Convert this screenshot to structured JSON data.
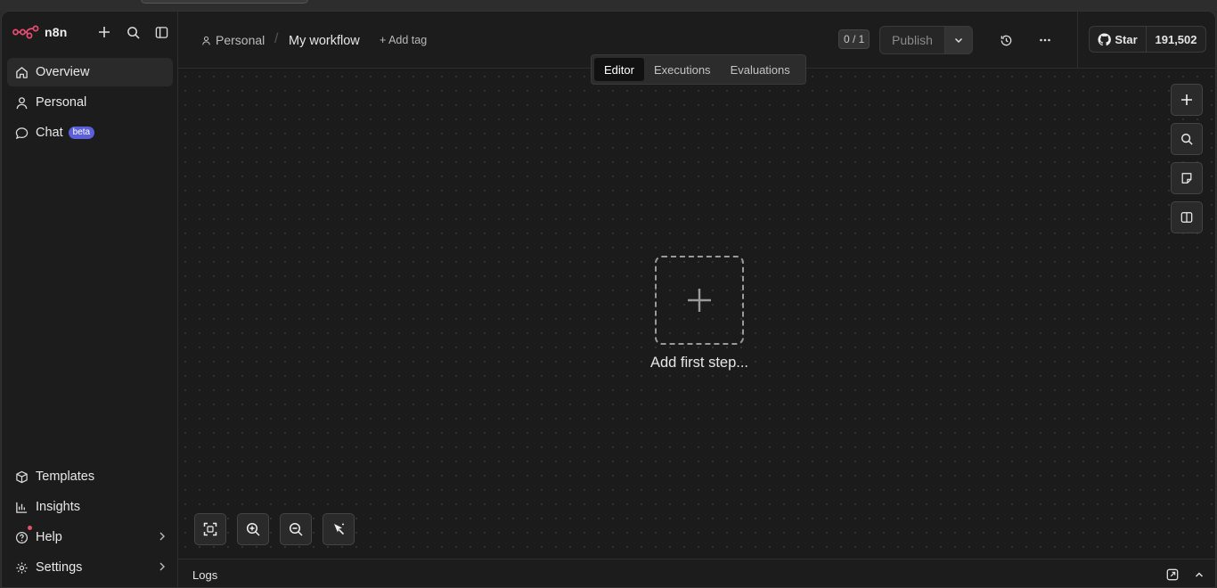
{
  "app": {
    "name": "n8n",
    "accent": "#ea4b71"
  },
  "sidebar": {
    "top_nav": [
      {
        "label": "Overview",
        "icon": "home-icon",
        "active": true
      },
      {
        "label": "Personal",
        "icon": "user-icon",
        "active": false
      },
      {
        "label": "Chat",
        "icon": "chat-icon",
        "badge": "beta",
        "active": false
      }
    ],
    "bottom_nav": [
      {
        "label": "Templates",
        "icon": "box-icon"
      },
      {
        "label": "Insights",
        "icon": "bar-chart-icon"
      },
      {
        "label": "Help",
        "icon": "help-icon",
        "has_submenu": true
      },
      {
        "label": "Settings",
        "icon": "gear-icon",
        "has_submenu": true
      }
    ]
  },
  "header": {
    "breadcrumb_project": "Personal",
    "breadcrumb_separator": "/",
    "workflow_title": "My workflow",
    "add_tag": "+ Add tag",
    "version_counter": "0 / 1",
    "publish_label": "Publish",
    "github": {
      "star_label": "Star",
      "star_count": "191,502"
    }
  },
  "mode_tabs": [
    {
      "label": "Editor",
      "active": true
    },
    {
      "label": "Executions",
      "active": false
    },
    {
      "label": "Evaluations",
      "active": false
    }
  ],
  "canvas": {
    "empty_prompt": "Add first step..."
  },
  "logs": {
    "label": "Logs"
  }
}
